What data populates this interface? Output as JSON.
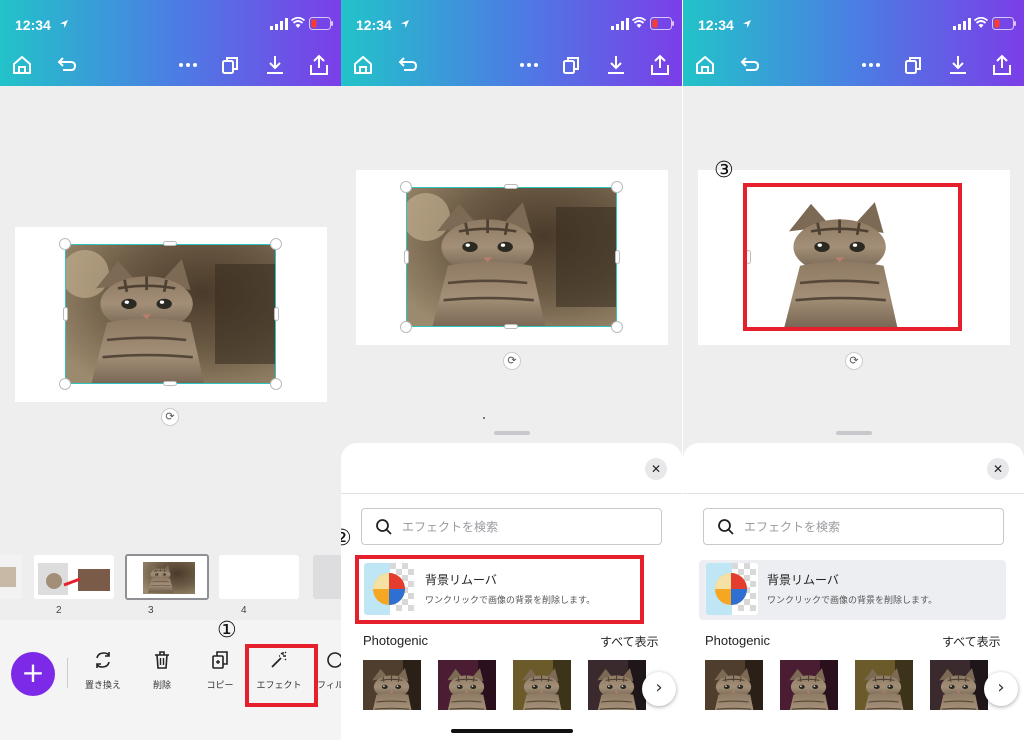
{
  "status_bar": {
    "time": "12:34"
  },
  "panel1": {
    "page_numbers": [
      "2",
      "3",
      "4"
    ],
    "tools": [
      {
        "label": "置き換え",
        "icon": "replace-icon"
      },
      {
        "label": "削除",
        "icon": "trash-icon"
      },
      {
        "label": "コピー",
        "icon": "copy-icon"
      },
      {
        "label": "エフェクト",
        "icon": "magic-wand-icon"
      },
      {
        "label": "フィル",
        "icon": "filter-icon"
      }
    ],
    "fab_label": "+",
    "marker": "①"
  },
  "effects_sheet": {
    "close_label": "✕",
    "search_placeholder": "エフェクトを検索",
    "bg_remover_title": "背景リムーバ",
    "bg_remover_desc": "ワンクリックで画像の背景を削除します。",
    "section_title": "Photogenic",
    "see_all": "すべて表示",
    "next_label": "›"
  },
  "panel2": {
    "marker": "②"
  },
  "panel3": {
    "marker": "③"
  },
  "colors": {
    "accent": "#7d2ae8",
    "selection": "#2ec4c0",
    "highlight": "#e5202c"
  },
  "icons": [
    "home-icon",
    "undo-icon",
    "more-icon",
    "pages-icon",
    "download-icon",
    "share-icon",
    "search-icon",
    "rotate-icon"
  ]
}
